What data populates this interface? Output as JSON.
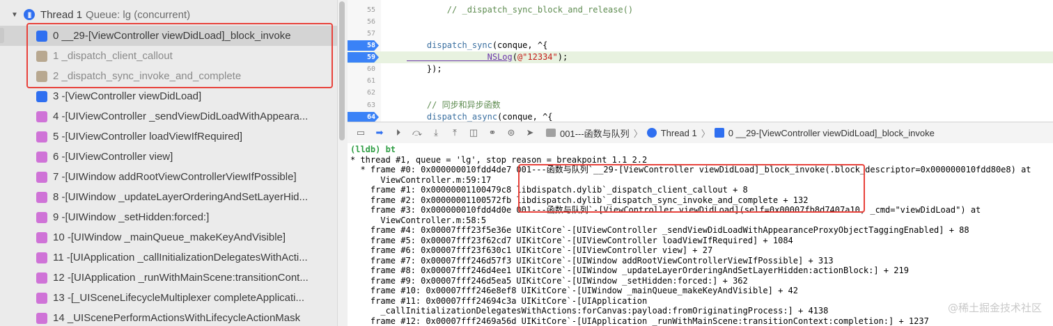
{
  "navigator": {
    "thread_label": "Thread 1",
    "queue_label": "Queue: lg (concurrent)",
    "frames": [
      {
        "text": "0 __29-[ViewController viewDidLoad]_block_invoke",
        "icon": "user-frame-icon"
      },
      {
        "text": "1 _dispatch_client_callout",
        "icon": "system-frame-icon"
      },
      {
        "text": "2 _dispatch_sync_invoke_and_complete",
        "icon": "system-frame-icon"
      },
      {
        "text": "3 -[ViewController viewDidLoad]",
        "icon": "user-frame-icon"
      },
      {
        "text": "4 -[UIViewController _sendViewDidLoadWithAppeara...",
        "icon": "framework-frame-icon"
      },
      {
        "text": "5 -[UIViewController loadViewIfRequired]",
        "icon": "framework-frame-icon"
      },
      {
        "text": "6 -[UIViewController view]",
        "icon": "framework-frame-icon"
      },
      {
        "text": "7 -[UIWindow addRootViewControllerViewIfPossible]",
        "icon": "framework-frame-icon"
      },
      {
        "text": "8 -[UIWindow _updateLayerOrderingAndSetLayerHid...",
        "icon": "framework-frame-icon"
      },
      {
        "text": "9 -[UIWindow _setHidden:forced:]",
        "icon": "framework-frame-icon"
      },
      {
        "text": "10 -[UIWindow _mainQueue_makeKeyAndVisible]",
        "icon": "framework-frame-icon"
      },
      {
        "text": "11 -[UIApplication _callInitializationDelegatesWithActi...",
        "icon": "framework-frame-icon"
      },
      {
        "text": "12 -[UIApplication _runWithMainScene:transitionCont...",
        "icon": "framework-frame-icon"
      },
      {
        "text": "13 -[_UISceneLifecycleMultiplexer completeApplicati...",
        "icon": "framework-frame-icon"
      },
      {
        "text": "14 _UIScenePerformActionsWithLifecycleActionMask",
        "icon": "framework-frame-icon"
      }
    ]
  },
  "editor": {
    "lines": [
      {
        "num": "55",
        "parts": [
          {
            "t": "        // _dispatch_sync_block_and_release()",
            "c": "cmt"
          }
        ]
      },
      {
        "num": "56",
        "parts": []
      },
      {
        "num": "57",
        "parts": []
      },
      {
        "num": "58",
        "parts": [
          {
            "t": "    dispatch_sync",
            "c": "fn"
          },
          {
            "t": "(conque, ^{",
            "c": ""
          }
        ],
        "breakpoint": true
      },
      {
        "num": "59",
        "parts": [
          {
            "t": "                NSLog",
            "c": "ns"
          },
          {
            "t": "(",
            "c": ""
          },
          {
            "t": "@\"12334\"",
            "c": "str"
          },
          {
            "t": ");",
            "c": ""
          }
        ],
        "breakpoint": true,
        "current": true
      },
      {
        "num": "60",
        "parts": [
          {
            "t": "    });",
            "c": ""
          }
        ]
      },
      {
        "num": "61",
        "parts": []
      },
      {
        "num": "62",
        "parts": []
      },
      {
        "num": "63",
        "parts": [
          {
            "t": "    // 同步和异步函数",
            "c": "cmt"
          }
        ]
      },
      {
        "num": "64",
        "parts": [
          {
            "t": "    dispatch_async",
            "c": "fn"
          },
          {
            "t": "(conque, ^{",
            "c": ""
          }
        ],
        "breakpoint": true
      }
    ]
  },
  "debugbar": {
    "breadcrumb_project": "001---函数与队列",
    "breadcrumb_thread": "Thread 1",
    "breadcrumb_frame": "0 __29-[ViewController viewDidLoad]_block_invoke"
  },
  "console": {
    "lines": [
      "(lldb) bt",
      "* thread #1, queue = 'lg', stop reason = breakpoint 1.1 2.2",
      "  * frame #0: 0x000000010fdd4de7 001---函数与队列`__29-[ViewController viewDidLoad]_block_invoke(.block_descriptor=0x000000010fdd80e8) at",
      "      ViewController.m:59:17",
      "    frame #1: 0x00000001100479c8 libdispatch.dylib`_dispatch_client_callout + 8",
      "    frame #2: 0x00000001100572fb libdispatch.dylib`_dispatch_sync_invoke_and_complete + 132",
      "    frame #3: 0x000000010fdd4d0e 001---函数与队列`-[ViewController viewDidLoad](self=0x00007fb8d7407a10, _cmd=\"viewDidLoad\") at",
      "      ViewController.m:58:5",
      "    frame #4: 0x00007fff23f5e36e UIKitCore`-[UIViewController _sendViewDidLoadWithAppearanceProxyObjectTaggingEnabled] + 88",
      "    frame #5: 0x00007fff23f62cd7 UIKitCore`-[UIViewController loadViewIfRequired] + 1084",
      "    frame #6: 0x00007fff23f630c1 UIKitCore`-[UIViewController view] + 27",
      "    frame #7: 0x00007fff246d57f3 UIKitCore`-[UIWindow addRootViewControllerViewIfPossible] + 313",
      "    frame #8: 0x00007fff246d4ee1 UIKitCore`-[UIWindow _updateLayerOrderingAndSetLayerHidden:actionBlock:] + 219",
      "    frame #9: 0x00007fff246d5ea5 UIKitCore`-[UIWindow _setHidden:forced:] + 362",
      "    frame #10: 0x00007fff246e8ef8 UIKitCore`-[UIWindow _mainQueue_makeKeyAndVisible] + 42",
      "    frame #11: 0x00007fff24694c3a UIKitCore`-[UIApplication",
      "      _callInitializationDelegatesWithActions:forCanvas:payload:fromOriginatingProcess:] + 4138",
      "    frame #12: 0x00007fff2469a56d UIKitCore`-[UIApplication _runWithMainScene:transitionContext:completion:] + 1237"
    ]
  },
  "watermark": "@稀土掘金技术社区"
}
